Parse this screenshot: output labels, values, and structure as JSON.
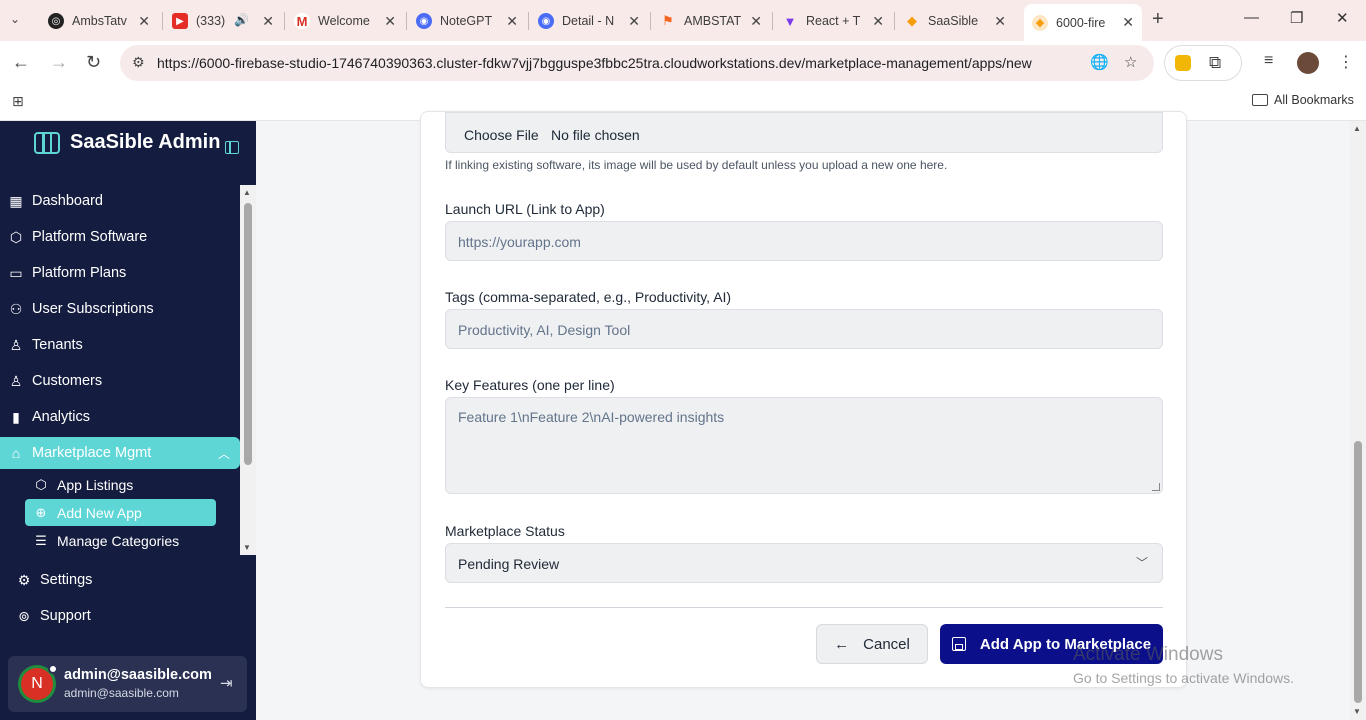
{
  "browser": {
    "tabs": [
      {
        "title": "AmbsTatv",
        "color": "#222"
      },
      {
        "title": "(333)",
        "color": "#e52d27"
      },
      {
        "title": "Welcome",
        "color": "#d93025"
      },
      {
        "title": "NoteGPT",
        "color": "#4a6cf7"
      },
      {
        "title": "Detail - N",
        "color": "#4a6cf7"
      },
      {
        "title": "AMBSTAT",
        "color": "#f26522"
      },
      {
        "title": "React + T",
        "color": "#7c3aed"
      },
      {
        "title": "SaaSible",
        "color": "#f59e0b"
      },
      {
        "title": "6000-fire",
        "color": "#f59e0b"
      }
    ],
    "url": "https://6000-firebase-studio-1746740390363.cluster-fdkw7vjj7bgguspe3fbbc25tra.cloudworkstations.dev/marketplace-management/apps/new",
    "all_bookmarks": "All Bookmarks"
  },
  "sidebar": {
    "brand": "SaaSible Admin",
    "items": [
      {
        "label": "Dashboard",
        "icon": "dashboard-icon"
      },
      {
        "label": "Platform Software",
        "icon": "box-icon"
      },
      {
        "label": "Platform Plans",
        "icon": "card-icon"
      },
      {
        "label": "User Subscriptions",
        "icon": "users-icon"
      },
      {
        "label": "Tenants",
        "icon": "user-icon"
      },
      {
        "label": "Customers",
        "icon": "user-icon"
      },
      {
        "label": "Analytics",
        "icon": "chart-icon"
      },
      {
        "label": "Marketplace Mgmt",
        "icon": "store-icon"
      }
    ],
    "sub_items": [
      {
        "label": "App Listings",
        "icon": "box-icon"
      },
      {
        "label": "Add New App",
        "icon": "plus-circle-icon"
      },
      {
        "label": "Manage Categories",
        "icon": "filter-icon"
      }
    ],
    "bottom": [
      {
        "label": "Settings",
        "icon": "gear-icon"
      },
      {
        "label": "Support",
        "icon": "help-icon"
      }
    ],
    "user": {
      "initial": "N",
      "name": "admin@saasible.com",
      "email": "admin@saasible.com"
    }
  },
  "form": {
    "file_button": "Choose File",
    "file_status": "No file chosen",
    "image_hint": "If linking existing software, its image will be used by default unless you upload a new one here.",
    "launch_label": "Launch URL (Link to App)",
    "launch_placeholder": "https://yourapp.com",
    "tags_label": "Tags (comma-separated, e.g., Productivity, AI)",
    "tags_placeholder": "Productivity, AI, Design Tool",
    "features_label": "Key Features (one per line)",
    "features_placeholder": "Feature 1\\nFeature 2\\nAI-powered insights",
    "status_label": "Marketplace Status",
    "status_value": "Pending Review",
    "cancel": "Cancel",
    "submit": "Add App to Marketplace"
  },
  "watermark": {
    "line1": "Activate Windows",
    "line2": "Go to Settings to activate Windows."
  }
}
